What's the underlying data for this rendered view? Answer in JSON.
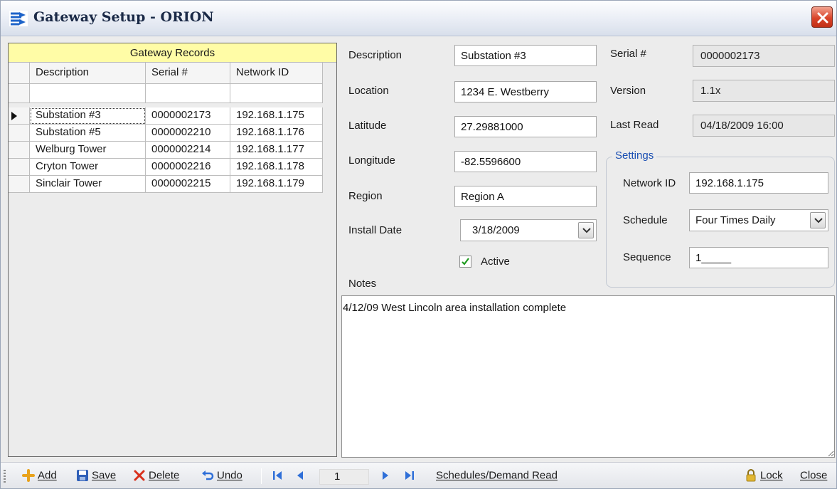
{
  "window": {
    "title": "Gateway Setup - ORION"
  },
  "grid": {
    "caption": "Gateway Records",
    "columns": [
      "Description",
      "Serial #",
      "Network ID"
    ],
    "rows": [
      {
        "description": "Substation #3",
        "serial": "0000002173",
        "network_id": "192.168.1.175"
      },
      {
        "description": "Substation #5",
        "serial": "0000002210",
        "network_id": "192.168.1.176"
      },
      {
        "description": "Welburg Tower",
        "serial": "0000002214",
        "network_id": "192.168.1.177"
      },
      {
        "description": "Cryton Tower",
        "serial": "0000002216",
        "network_id": "192.168.1.178"
      },
      {
        "description": "Sinclair Tower",
        "serial": "0000002215",
        "network_id": "192.168.1.179"
      }
    ]
  },
  "form": {
    "description_label": "Description",
    "description_value": "Substation #3",
    "location_label": "Location",
    "location_value": "1234 E. Westberry",
    "latitude_label": "Latitude",
    "latitude_value": "27.29881000",
    "longitude_label": "Longitude",
    "longitude_value": "-82.5596600",
    "region_label": "Region",
    "region_value": "Region A",
    "install_date_label": "Install Date",
    "install_date_value": "3/18/2009",
    "active_label": "Active",
    "active_checked": true,
    "notes_label": "Notes",
    "notes_value": "4/12/09 West Lincoln area installation complete",
    "serial_label": "Serial #",
    "serial_value": "0000002173",
    "version_label": "Version",
    "version_value": "1.1x",
    "last_read_label": "Last Read",
    "last_read_value": "04/18/2009 16:00"
  },
  "settings": {
    "legend": "Settings",
    "network_id_label": "Network ID",
    "network_id_value": "192.168.1.175",
    "schedule_label": "Schedule",
    "schedule_value": "Four Times Daily",
    "sequence_label": "Sequence",
    "sequence_value": "1_____"
  },
  "toolbar": {
    "add_label": "Add",
    "save_label": "Save",
    "delete_label": "Delete",
    "undo_label": "Undo",
    "position": "1",
    "schedules_label": "Schedules/Demand Read",
    "lock_label": "Lock",
    "close_label": "Close"
  },
  "colors": {
    "caption_bg": "#fffca6",
    "legend_text": "#1b4fb3",
    "nav_blue": "#2f6fd8",
    "delete_red": "#d8301c"
  }
}
